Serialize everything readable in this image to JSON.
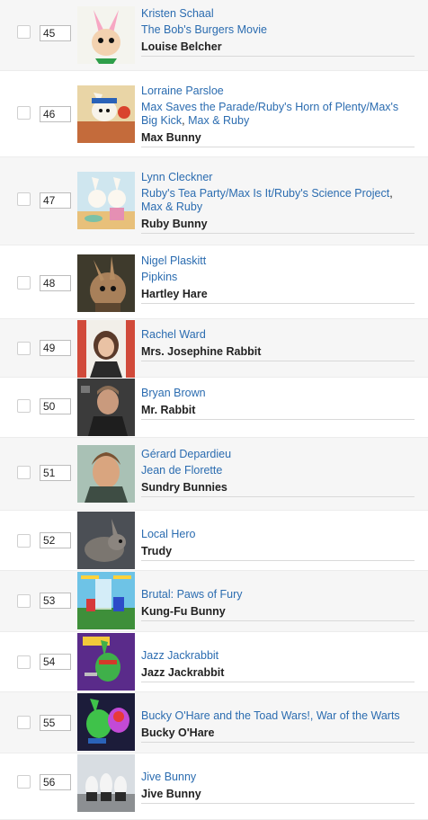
{
  "rows": [
    {
      "rank": "45",
      "actor": "Kristen Schaal",
      "titles": [
        "The Bob's Burgers Movie"
      ],
      "role": "Louise Belcher",
      "thumb": "louise-belcher-cartoon-image"
    },
    {
      "rank": "46",
      "actor": "Lorraine Parsloe",
      "titles": [
        "Max Saves the Parade/Ruby's Horn of Plenty/Max's Big Kick",
        "Max & Ruby"
      ],
      "role": "Max Bunny",
      "thumb": "max-bunny-cartoon-image"
    },
    {
      "rank": "47",
      "actor": "Lynn Cleckner",
      "titles": [
        "Ruby's Tea Party/Max Is It/Ruby's Science Project",
        "Max & Ruby"
      ],
      "role": "Ruby Bunny",
      "thumb": "ruby-bunny-cartoon-image"
    },
    {
      "rank": "48",
      "actor": "Nigel Plaskitt",
      "titles": [
        "Pipkins"
      ],
      "role": "Hartley Hare",
      "thumb": "hartley-hare-puppet-image"
    },
    {
      "rank": "49",
      "actor": "Rachel Ward",
      "titles": [],
      "role": "Mrs. Josephine Rabbit",
      "thumb": "rachel-ward-photo"
    },
    {
      "rank": "50",
      "actor": "Bryan Brown",
      "titles": [],
      "role": "Mr. Rabbit",
      "thumb": "bryan-brown-photo"
    },
    {
      "rank": "51",
      "actor": "Gérard Depardieu",
      "titles": [
        "Jean de Florette"
      ],
      "role": "Sundry Bunnies",
      "thumb": "gerard-depardieu-photo"
    },
    {
      "rank": "52",
      "actor": "Local Hero",
      "titles": [],
      "role": "Trudy",
      "thumb": "rabbit-photo"
    },
    {
      "rank": "53",
      "actor": "Brutal: Paws of Fury",
      "titles": [],
      "role": "Kung-Fu Bunny",
      "thumb": "brutal-game-screenshot"
    },
    {
      "rank": "54",
      "actor": "Jazz Jackrabbit",
      "titles": [],
      "role": "Jazz Jackrabbit",
      "thumb": "jazz-jackrabbit-cover"
    },
    {
      "rank": "55",
      "actor": "Bucky O'Hare and the Toad Wars!, War of the Warts",
      "titles": [],
      "role": "Bucky O'Hare",
      "thumb": "bucky-ohare-cartoon-image"
    },
    {
      "rank": "56",
      "actor": "Jive Bunny",
      "titles": [],
      "role": "Jive Bunny",
      "thumb": "jive-bunny-photo"
    }
  ],
  "colors": {
    "link": "#2b6cb0",
    "text": "#222222",
    "row_alt": "#f6f6f6"
  }
}
